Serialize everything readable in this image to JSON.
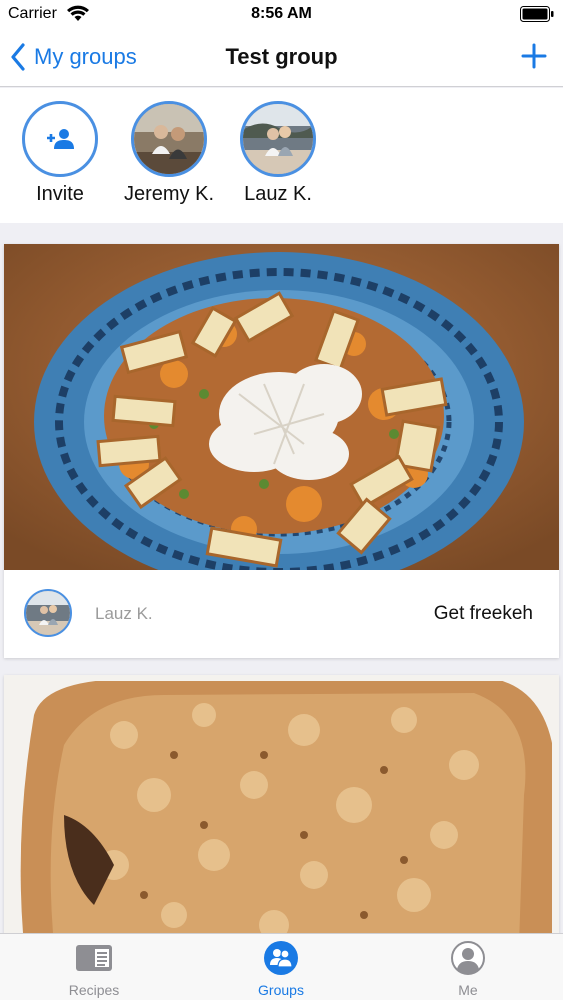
{
  "status_bar": {
    "carrier": "Carrier",
    "time": "8:56 AM"
  },
  "nav": {
    "back_label": "My groups",
    "title": "Test group"
  },
  "members": [
    {
      "name": "Invite",
      "icon": "add-person-icon"
    },
    {
      "name": "Jeremy K.",
      "icon": "avatar"
    },
    {
      "name": "Lauz K.",
      "icon": "avatar"
    }
  ],
  "feed": {
    "posts": [
      {
        "author": "Lauz K.",
        "title": "Get freekeh",
        "photo": "freekeh salad with halloumi and chicken on a blue patterned plate"
      },
      {
        "author": "",
        "title": "",
        "photo": "baked crumble in a white dish"
      }
    ]
  },
  "tabs": [
    {
      "label": "Recipes",
      "icon": "recipes-book-icon",
      "active": false
    },
    {
      "label": "Groups",
      "icon": "groups-icon",
      "active": true
    },
    {
      "label": "Me",
      "icon": "profile-icon",
      "active": false
    }
  ],
  "colors": {
    "accent": "#1a7ae4",
    "avatar_ring": "#4a90e2",
    "background": "#efeff4"
  }
}
